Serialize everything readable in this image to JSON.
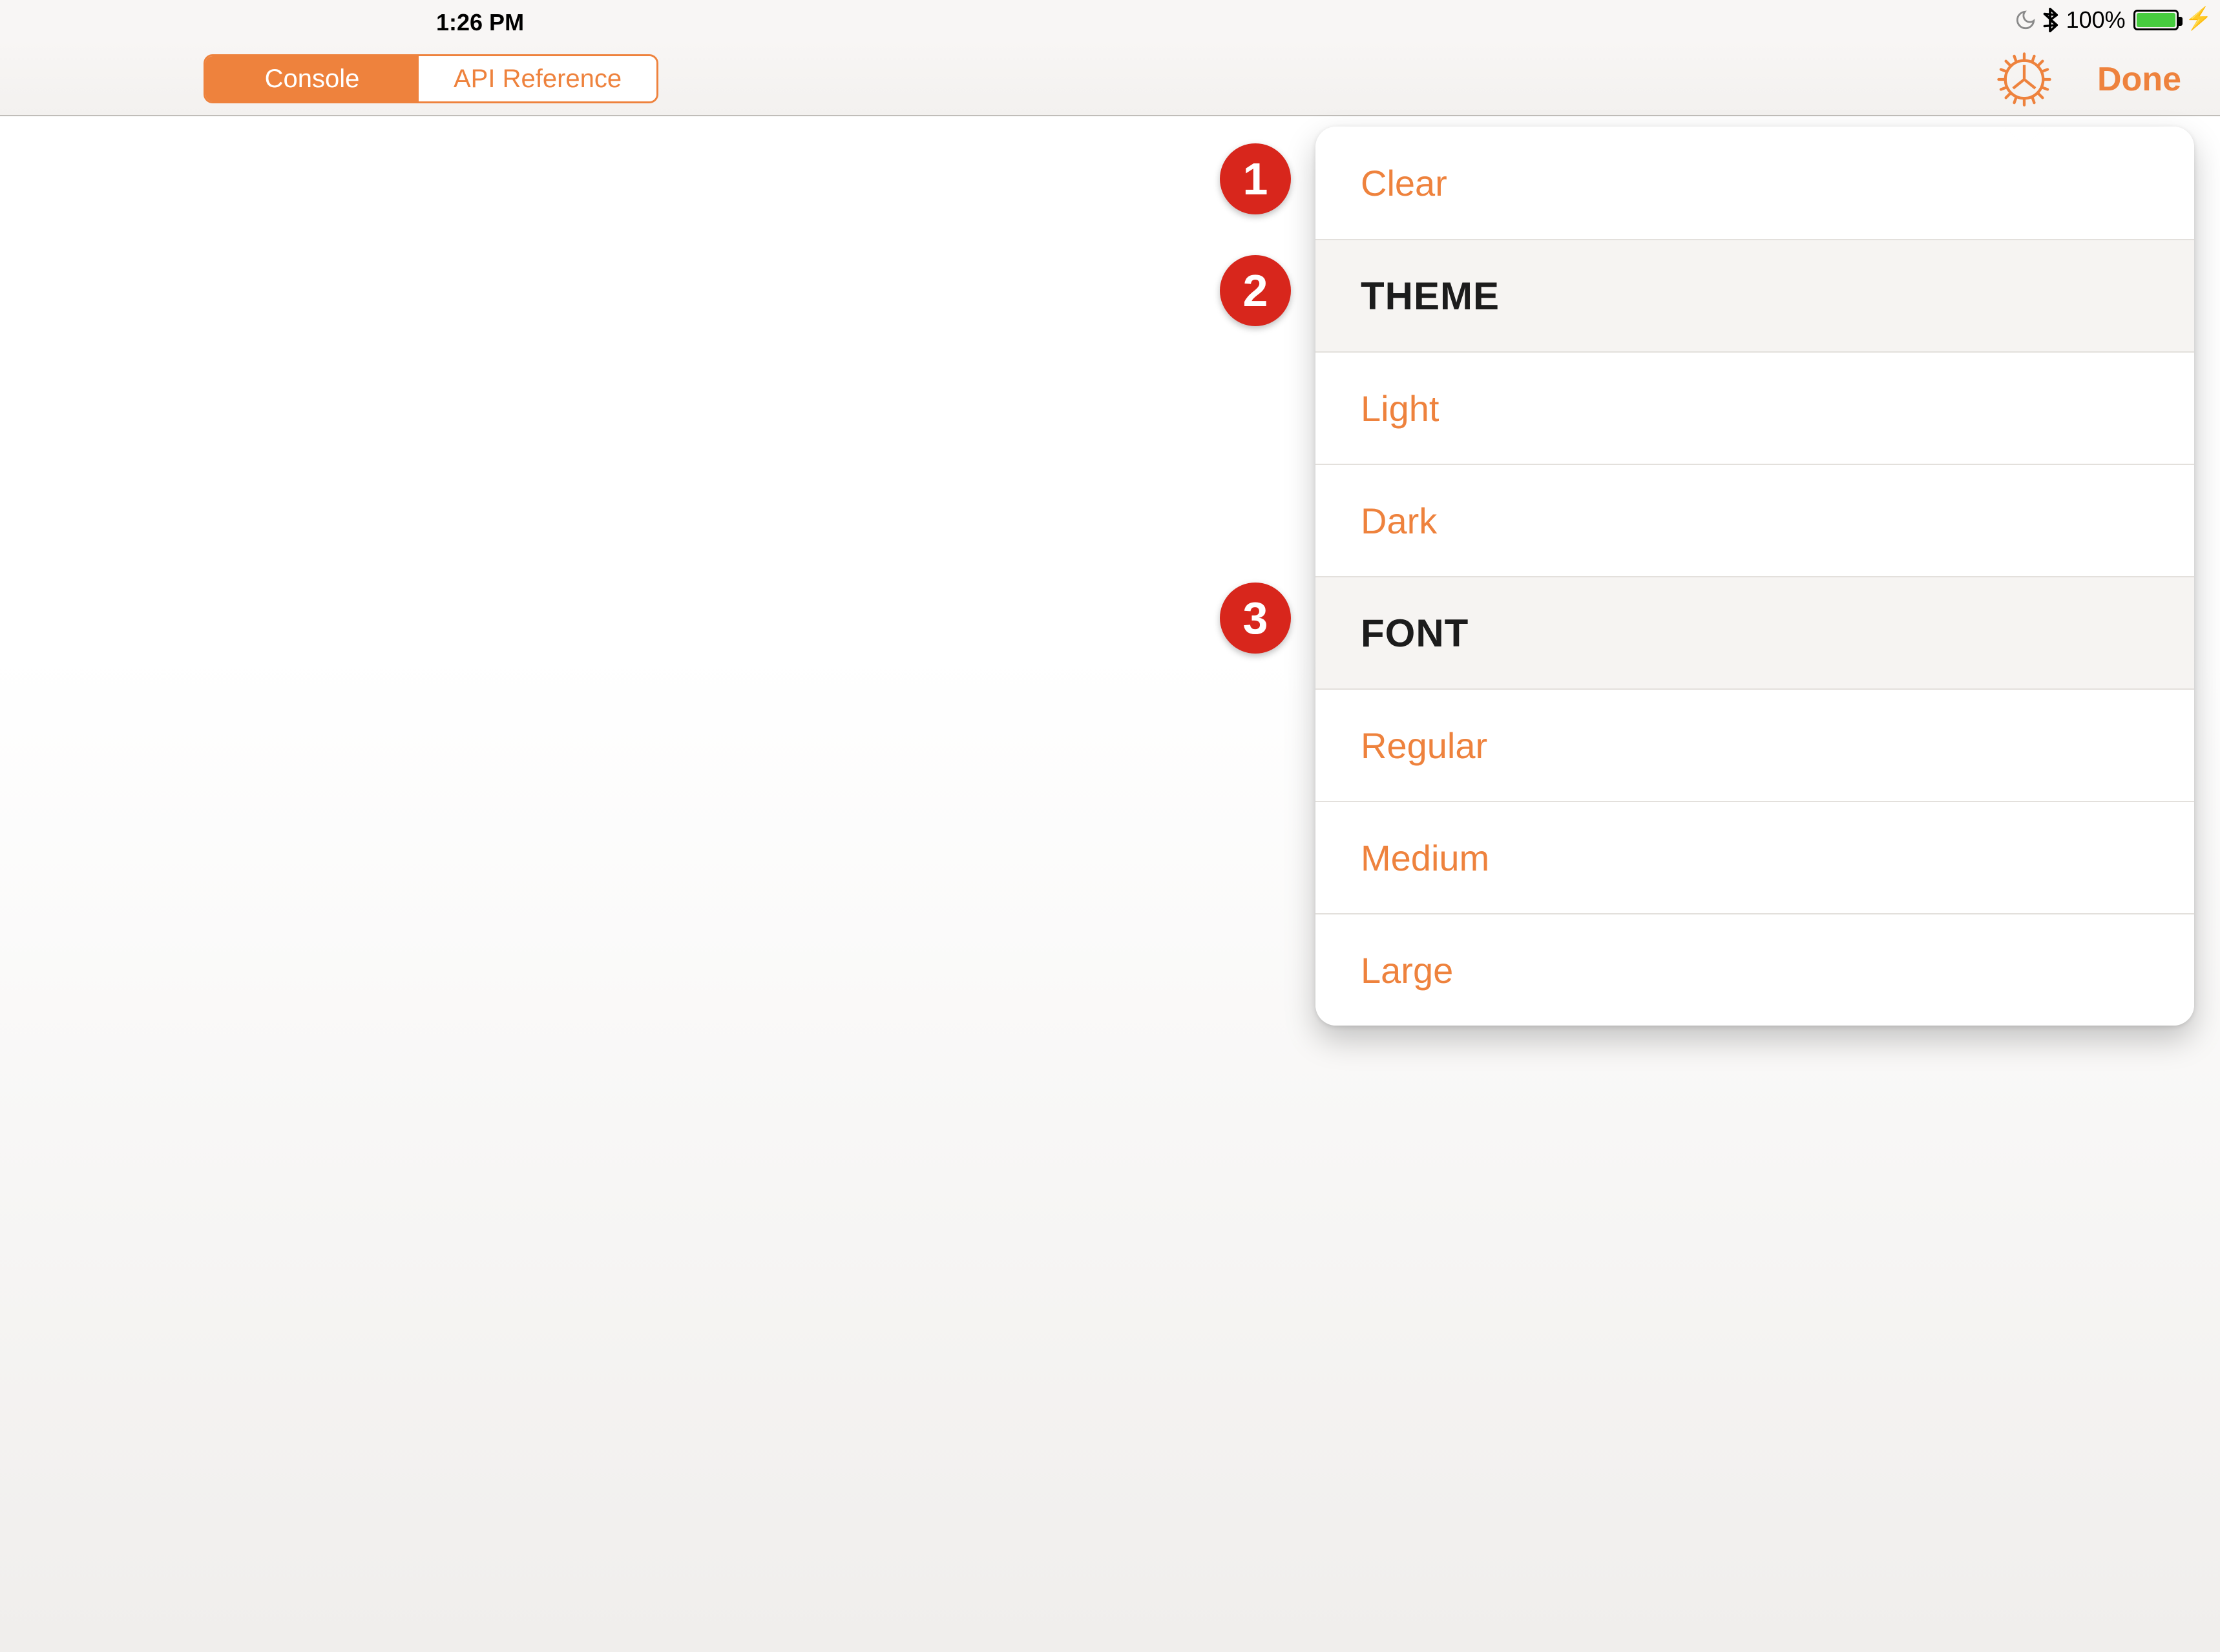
{
  "status": {
    "time": "1:26 PM",
    "battery_pct": "100%",
    "dnd": true,
    "bluetooth": true,
    "charging": true
  },
  "nav": {
    "segmented": {
      "console": "Console",
      "api": "API Reference",
      "active": "console"
    },
    "done": "Done"
  },
  "popover": {
    "clear": "Clear",
    "theme": {
      "header": "THEME",
      "options": {
        "light": "Light",
        "dark": "Dark"
      }
    },
    "font": {
      "header": "FONT",
      "options": {
        "regular": "Regular",
        "medium": "Medium",
        "large": "Large"
      }
    }
  },
  "callouts": {
    "one": "1",
    "two": "2",
    "three": "3"
  },
  "colors": {
    "accent": "#ee823d",
    "callout": "#d8261c",
    "battery_fill": "#47cc3f"
  }
}
